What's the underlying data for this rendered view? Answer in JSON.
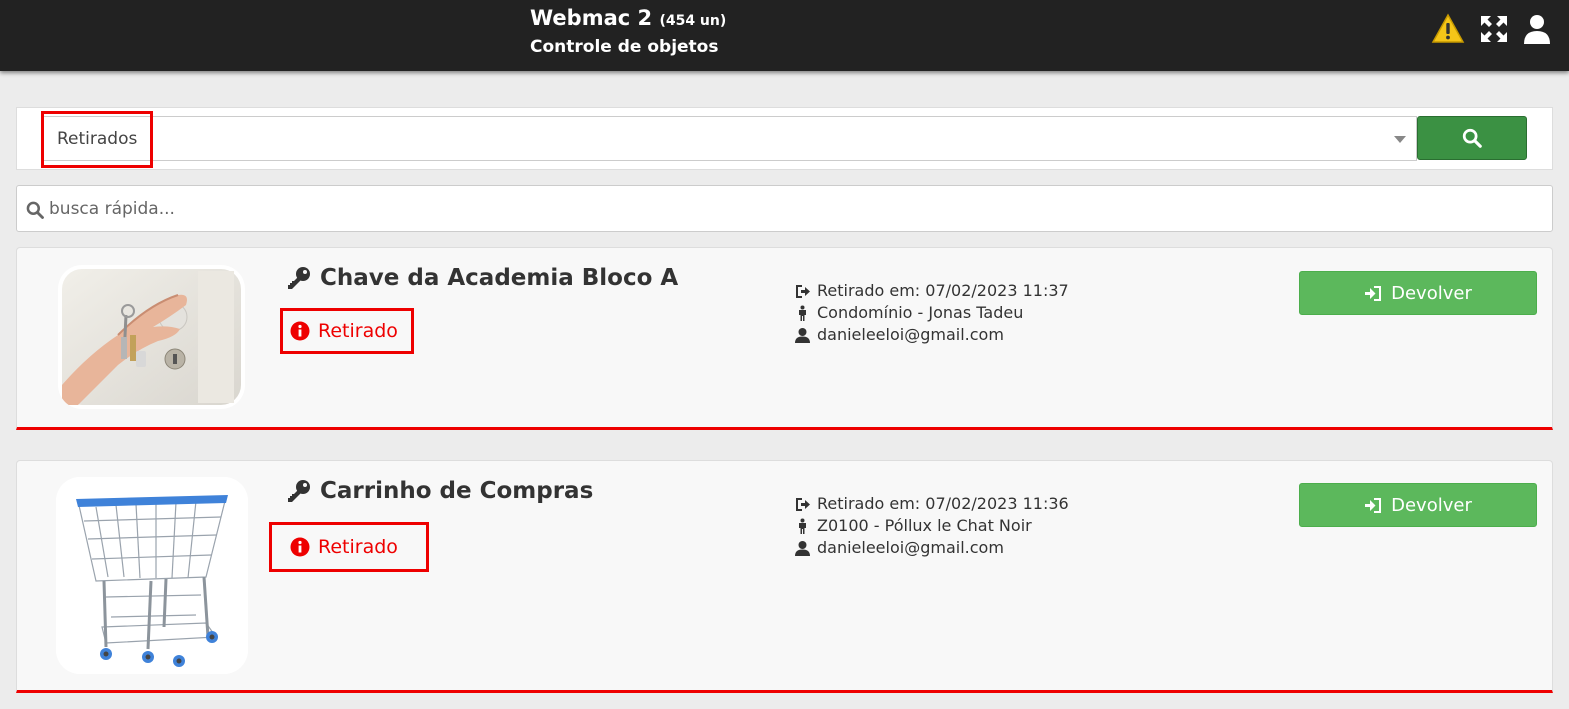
{
  "header": {
    "app_name": "Webmac 2",
    "item_count": "(454 un)",
    "subtitle": "Controle de objetos",
    "icons": [
      "warning-icon",
      "expand-icon",
      "user-icon"
    ]
  },
  "filter": {
    "selected": "Retirados",
    "search_button_icon": "search-icon"
  },
  "quick_search": {
    "placeholder": "busca rápida..."
  },
  "items": [
    {
      "title": "Chave da Academia Bloco A",
      "title_icon": "key-icon",
      "status": "Retirado",
      "withdrawn": "Retirado em: 07/02/2023 11:37",
      "holder": "Condomínio - Jonas Tadeu",
      "user": "danieleeloi@gmail.com",
      "action": "Devolver",
      "image": "hand-holding-keys"
    },
    {
      "title": "Carrinho de Compras",
      "title_icon": "key-icon",
      "status": "Retirado",
      "withdrawn": "Retirado em: 07/02/2023 11:36",
      "holder": "Z0100 - Póllux le Chat Noir",
      "user": "danieleeloi@gmail.com",
      "action": "Devolver",
      "image": "shopping-cart"
    }
  ],
  "colors": {
    "topbar": "#222222",
    "status_red": "#ee0000",
    "button_green": "#5cb85c",
    "search_green": "#3b9143"
  }
}
